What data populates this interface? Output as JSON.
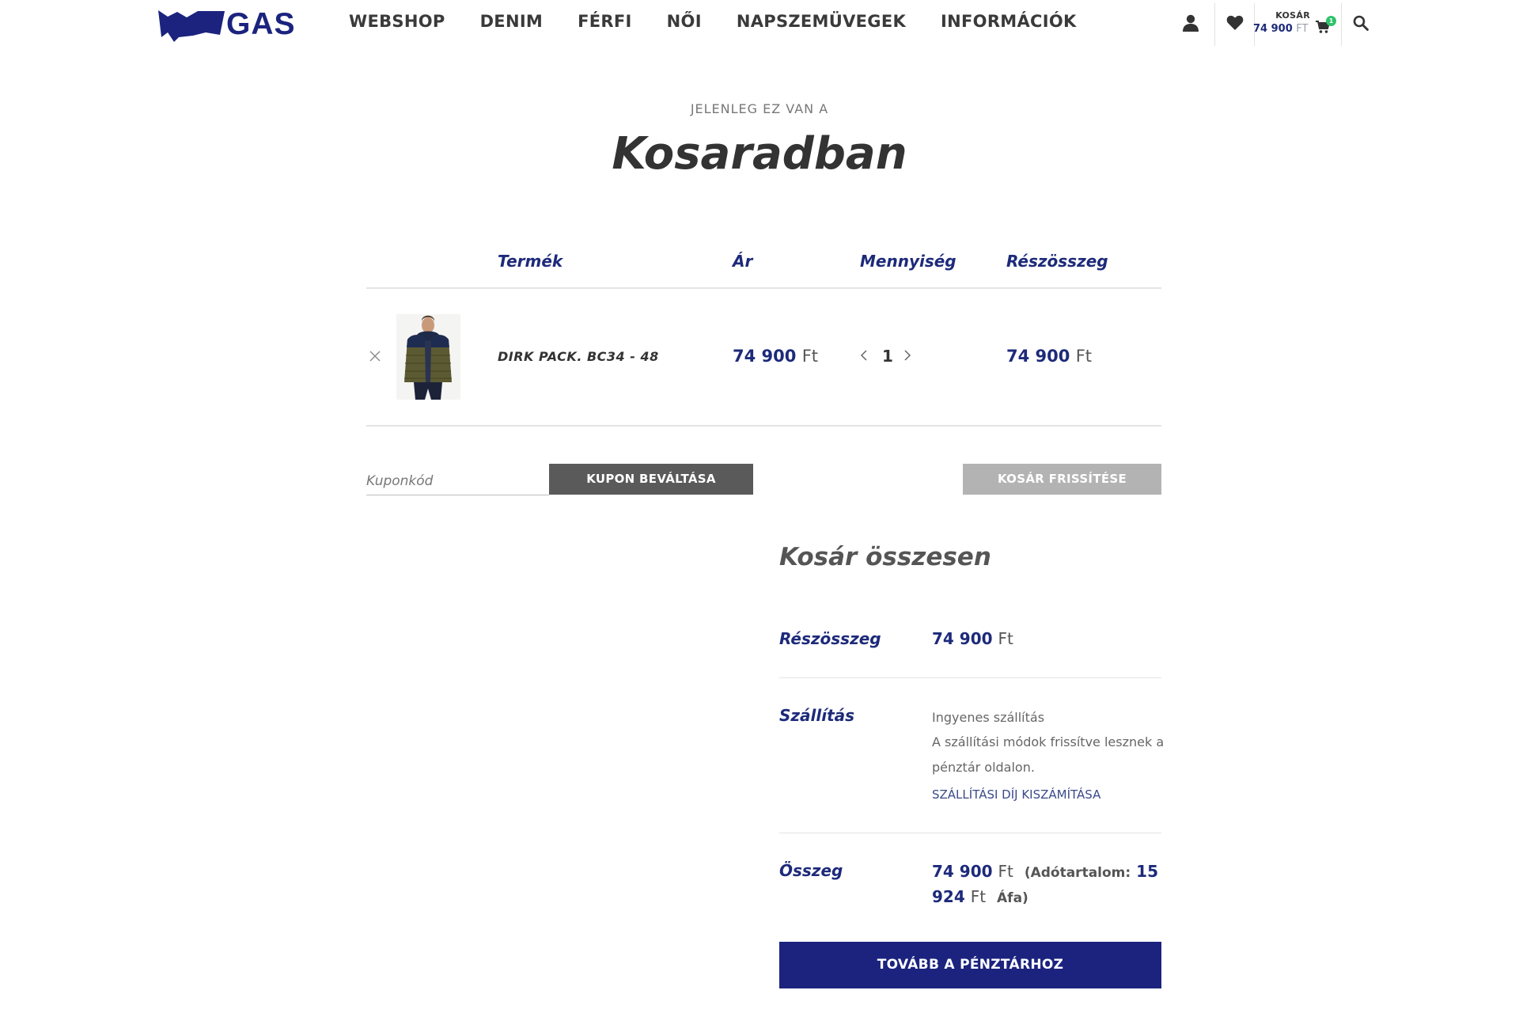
{
  "header": {
    "brand": "GAS",
    "nav": [
      "WEBSHOP",
      "DENIM",
      "FÉRFI",
      "NŐI",
      "NAPSZEMÜVEGEK",
      "INFORMÁCIÓK"
    ],
    "cart_label": "KOSÁR",
    "cart_amount": "74 900",
    "cart_currency": "FT",
    "cart_count": "1"
  },
  "page": {
    "subtitle": "JELENLEG EZ VAN A",
    "title": "Kosaradban"
  },
  "cart_table": {
    "headers": {
      "product": "Termék",
      "price": "Ár",
      "quantity": "Mennyiség",
      "subtotal": "Részösszeg"
    },
    "items": [
      {
        "name": "DIRK PACK. BC34 - 48",
        "price": "74 900",
        "currency": "Ft",
        "quantity": "1",
        "subtotal": "74 900",
        "subtotal_currency": "Ft"
      }
    ]
  },
  "coupon": {
    "placeholder": "Kuponkód",
    "apply_label": "KUPON BEVÁLTÁSA",
    "update_label": "KOSÁR FRISSÍTÉSE"
  },
  "totals": {
    "title": "Kosár összesen",
    "subtotal_label": "Részösszeg",
    "subtotal_value": "74 900",
    "subtotal_currency": "Ft",
    "shipping_label": "Szállítás",
    "shipping_method": "Ingyenes szállítás",
    "shipping_note_line1": "A szállítási módok frissítve lesznek a",
    "shipping_note_line2": "pénztár oldalon.",
    "shipping_calc_link": "SZÁLLÍTÁSI DÍJ KISZÁMÍTÁSA",
    "total_label": "Összeg",
    "total_value": "74 900",
    "total_currency": "Ft",
    "tax_prefix": "(Adótartalom:",
    "tax_value_part1": "15",
    "tax_value_part2": "924",
    "tax_currency": "Ft",
    "tax_suffix": "Áfa)",
    "checkout_label": "TOVÁBB A PÉNZTÁRHOZ"
  },
  "colors": {
    "brand_navy": "#1b237e",
    "badge_green": "#2ec36b",
    "button_gray_dark": "#5a5a5a",
    "button_gray_light": "#b3b3b3"
  },
  "icons": [
    "user-icon",
    "heart-icon",
    "cart-icon",
    "search-icon",
    "remove-icon",
    "chevron-left-icon",
    "chevron-right-icon"
  ]
}
